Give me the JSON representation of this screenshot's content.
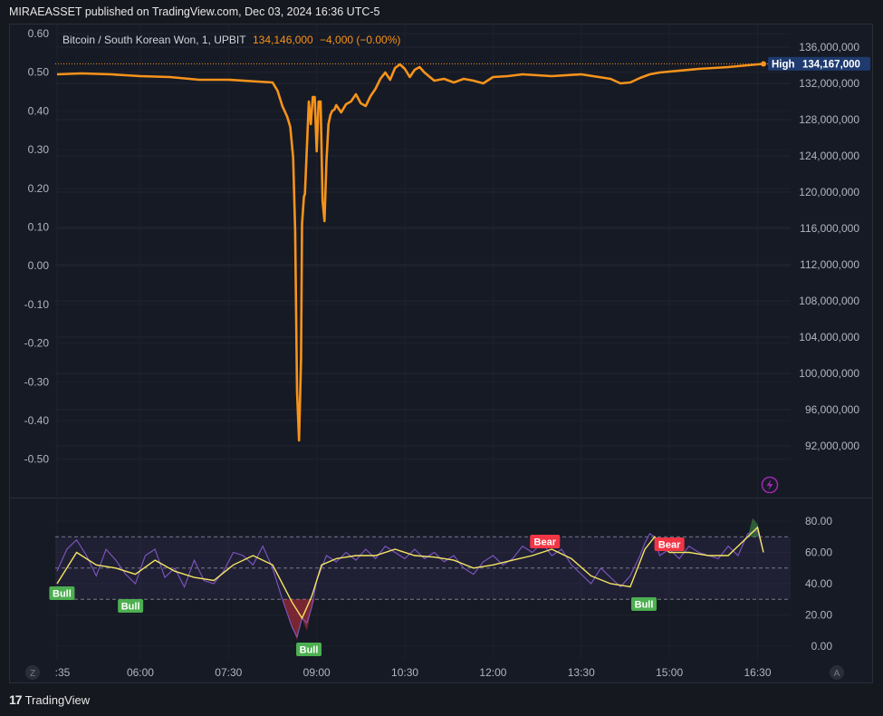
{
  "header": {
    "publisher_line": "MIRAEASSET published on TradingView.com, Dec 03, 2024 16:36 UTC-5"
  },
  "legend": {
    "symbol": "Bitcoin / South Korean Won, 1, UPBIT",
    "price": "134,146,000",
    "change": "−4,000 (−0.00%)"
  },
  "high_label": {
    "label": "High",
    "value": "134,167,000"
  },
  "footer": {
    "brand": "TradingView"
  },
  "colors": {
    "price_line": "#f7931a",
    "rsi_line": "#7e57c2",
    "signal_line": "#f5e663",
    "bull": "#4caf50",
    "bear": "#f23645",
    "high_badge": "#1e3a6e",
    "accent_icon": "#9c27b0"
  },
  "chart_data": [
    {
      "type": "line",
      "title": "Bitcoin / South Korean Won, 1, UPBIT",
      "ylim": [
        90000000,
        137500000
      ],
      "left_axis_ticks": [
        "0.60",
        "0.50",
        "0.40",
        "0.30",
        "0.20",
        "0.10",
        "0.00",
        "-0.10",
        "-0.20",
        "-0.30",
        "-0.40",
        "-0.50"
      ],
      "right_axis_ticks": [
        "136,000,000",
        "132,000,000",
        "128,000,000",
        "124,000,000",
        "120,000,000",
        "116,000,000",
        "112,000,000",
        "108,000,000",
        "104,000,000",
        "100,000,000",
        "96,000,000",
        "92,000,000"
      ],
      "x_ticks": [
        ":35",
        "06:00",
        "07:30",
        "09:00",
        "10:30",
        "12:00",
        "13:30",
        "15:00",
        "16:30"
      ],
      "series": [
        {
          "x": [
            "04:35",
            "05:00",
            "05:30",
            "05:45",
            "06:00",
            "06:30",
            "07:00",
            "07:30",
            "08:00",
            "08:15",
            "08:20",
            "08:25",
            "08:30",
            "08:33",
            "08:36",
            "08:38",
            "08:40",
            "08:42",
            "08:44",
            "08:45",
            "08:47",
            "08:48",
            "08:50",
            "08:52",
            "08:54",
            "08:56",
            "08:58",
            "09:00",
            "09:02",
            "09:04",
            "09:06",
            "09:08",
            "09:10",
            "09:12",
            "09:14",
            "09:16",
            "09:18",
            "09:20",
            "09:25",
            "09:30",
            "09:35",
            "09:40",
            "09:45",
            "09:50",
            "09:55",
            "10:00",
            "10:05",
            "10:10",
            "10:15",
            "10:20",
            "10:25",
            "10:30",
            "10:35",
            "10:40",
            "10:45",
            "10:50",
            "11:00",
            "11:10",
            "11:20",
            "11:30",
            "11:40",
            "11:50",
            "12:00",
            "12:15",
            "12:30",
            "13:00",
            "13:30",
            "14:00",
            "14:10",
            "14:20",
            "14:30",
            "14:40",
            "14:50",
            "15:00",
            "15:30",
            "16:00",
            "16:30",
            "16:36"
          ],
          "y": [
            133000000,
            133100000,
            133000000,
            132900000,
            132800000,
            132700000,
            132400000,
            132400000,
            132200000,
            132100000,
            131200000,
            129500000,
            128300000,
            127200000,
            123800000,
            115800000,
            98000000,
            92600000,
            101500000,
            116500000,
            119500000,
            119800000,
            125000000,
            130000000,
            127500000,
            130500000,
            130500000,
            124500000,
            130000000,
            130000000,
            119000000,
            116800000,
            123500000,
            127500000,
            128500000,
            129000000,
            129100000,
            129600000,
            128800000,
            129700000,
            130000000,
            130800000,
            129800000,
            129500000,
            130600000,
            131400000,
            132500000,
            133200000,
            132400000,
            133700000,
            134100000,
            133600000,
            132700000,
            133500000,
            133800000,
            133200000,
            132300000,
            132500000,
            132100000,
            132500000,
            132300000,
            132000000,
            132700000,
            132800000,
            133000000,
            132800000,
            133000000,
            132500000,
            132000000,
            132100000,
            132600000,
            133000000,
            133200000,
            133300000,
            133600000,
            133800000,
            134100000,
            134146000
          ]
        }
      ],
      "annotations": [
        "High 134,167,000"
      ]
    },
    {
      "type": "line",
      "ylim": [
        0,
        85
      ],
      "y_ticks": [
        "80.00",
        "60.00",
        "40.00",
        "20.00",
        "0.00"
      ],
      "bands": [
        30,
        50,
        70
      ],
      "series": [
        {
          "x": [
            "04:35",
            "04:45",
            "04:55",
            "05:05",
            "05:15",
            "05:25",
            "05:35",
            "05:45",
            "05:55",
            "06:05",
            "06:15",
            "06:25",
            "06:35",
            "06:45",
            "06:55",
            "07:05",
            "07:15",
            "07:25",
            "07:35",
            "07:45",
            "07:55",
            "08:05",
            "08:15",
            "08:25",
            "08:35",
            "08:40",
            "08:45",
            "08:50",
            "08:55",
            "09:00",
            "09:10",
            "09:20",
            "09:30",
            "09:40",
            "09:50",
            "10:00",
            "10:10",
            "10:20",
            "10:30",
            "10:40",
            "10:50",
            "11:00",
            "11:10",
            "11:20",
            "11:30",
            "11:40",
            "11:50",
            "12:00",
            "12:10",
            "12:20",
            "12:30",
            "12:40",
            "12:50",
            "13:00",
            "13:10",
            "13:20",
            "13:30",
            "13:40",
            "13:50",
            "14:00",
            "14:10",
            "14:20",
            "14:30",
            "14:35",
            "14:40",
            "14:45",
            "14:50",
            "15:00",
            "15:10",
            "15:20",
            "15:30",
            "15:40",
            "15:50",
            "16:00",
            "16:10",
            "16:20",
            "16:30",
            "16:36"
          ],
          "y": [
            48,
            62,
            68,
            58,
            45,
            62,
            55,
            46,
            40,
            58,
            62,
            44,
            50,
            38,
            55,
            42,
            40,
            48,
            60,
            58,
            52,
            64,
            50,
            30,
            12,
            6,
            18,
            15,
            25,
            42,
            58,
            54,
            60,
            55,
            62,
            56,
            64,
            60,
            56,
            62,
            56,
            60,
            54,
            58,
            50,
            46,
            54,
            58,
            52,
            56,
            64,
            60,
            66,
            58,
            62,
            52,
            46,
            40,
            50,
            44,
            38,
            45,
            58,
            66,
            72,
            70,
            58,
            62,
            56,
            64,
            60,
            58,
            56,
            64,
            58,
            72,
            74,
            60
          ]
        },
        {
          "x": [
            "04:35",
            "04:55",
            "05:15",
            "05:35",
            "05:55",
            "06:15",
            "06:35",
            "06:55",
            "07:15",
            "07:35",
            "07:55",
            "08:15",
            "08:35",
            "08:45",
            "08:55",
            "09:05",
            "09:20",
            "09:40",
            "10:00",
            "10:20",
            "10:40",
            "11:00",
            "11:20",
            "11:40",
            "12:00",
            "12:20",
            "12:40",
            "13:00",
            "13:20",
            "13:40",
            "14:00",
            "14:20",
            "14:35",
            "14:45",
            "15:00",
            "15:20",
            "15:40",
            "16:00",
            "16:20",
            "16:30",
            "16:36"
          ],
          "y": [
            40,
            60,
            52,
            50,
            46,
            55,
            48,
            44,
            42,
            52,
            58,
            52,
            28,
            18,
            32,
            52,
            56,
            58,
            58,
            62,
            58,
            57,
            55,
            50,
            52,
            55,
            58,
            62,
            56,
            45,
            40,
            38,
            62,
            70,
            60,
            60,
            58,
            58,
            70,
            76,
            60
          ]
        }
      ],
      "signals": [
        {
          "label": "Bull",
          "time": "04:40"
        },
        {
          "label": "Bull",
          "time": "05:50"
        },
        {
          "label": "Bull",
          "time": "08:52"
        },
        {
          "label": "Bear",
          "time": "12:53"
        },
        {
          "label": "Bear",
          "time": "15:00"
        },
        {
          "label": "Bull",
          "time": "14:34"
        }
      ]
    }
  ],
  "icons": {
    "zoom_left": "Z",
    "auto_right": "A",
    "lightning": "lightning-icon"
  }
}
